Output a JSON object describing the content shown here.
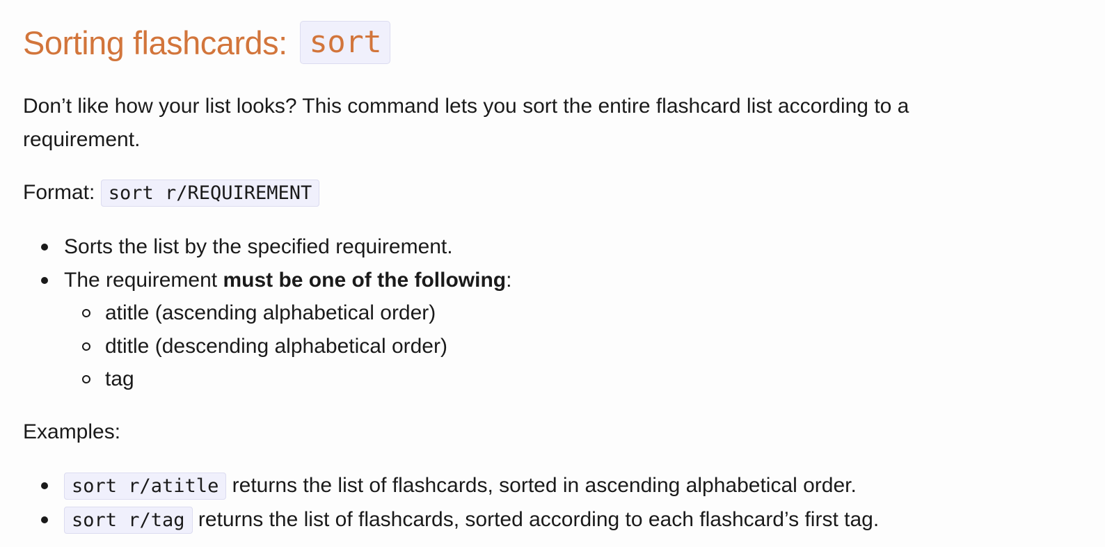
{
  "section": {
    "title_text": "Sorting flashcards: ",
    "title_code": "sort"
  },
  "intro": "Don’t like how your list looks? This command lets you sort the entire flashcard list according to a requirement.",
  "format": {
    "label": "Format: ",
    "code": "sort r/REQUIREMENT"
  },
  "details": [
    {
      "text": "Sorts the list by the specified requirement."
    },
    {
      "prefix": "The requirement ",
      "bold": "must be one of the following",
      "suffix": ":",
      "options": [
        "atitle (ascending alphabetical order)",
        "dtitle (descending alphabetical order)",
        "tag"
      ]
    }
  ],
  "examples": {
    "label": "Examples:",
    "items": [
      {
        "code": "sort r/atitle",
        "text": " returns the list of flashcards, sorted in ascending alphabetical order."
      },
      {
        "code": "sort r/tag",
        "text": " returns the list of flashcards, sorted according to each flashcard’s first tag."
      }
    ]
  }
}
